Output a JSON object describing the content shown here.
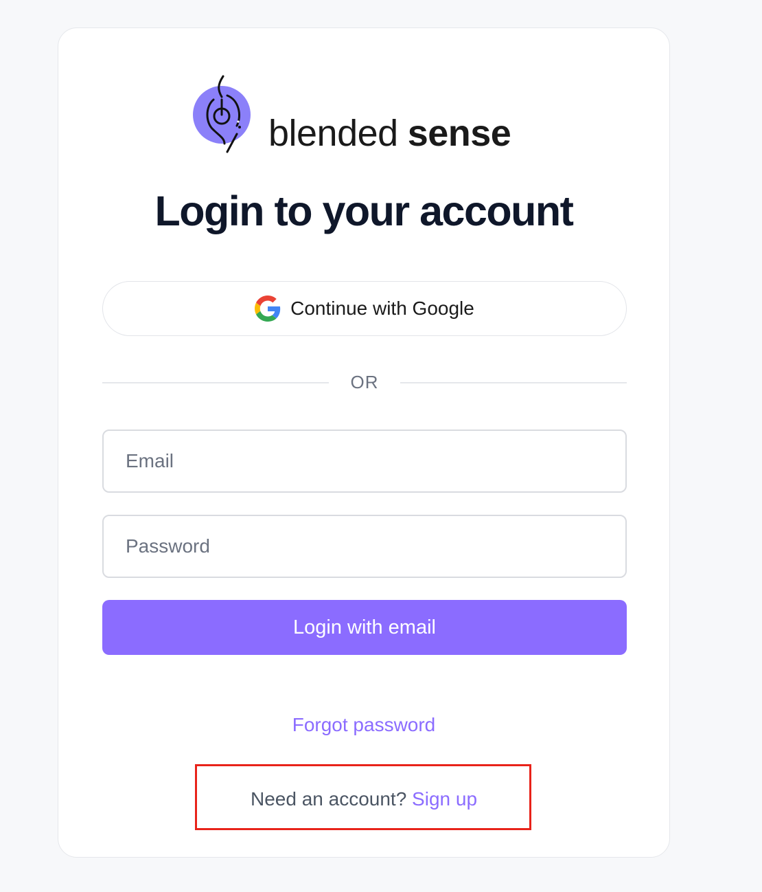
{
  "brand": {
    "name_light": "blended",
    "name_bold": "sense",
    "logo_icon": "blended-sense-logo-icon",
    "accent_color": "#8b6cff"
  },
  "title": "Login to your account",
  "google_button": {
    "label": "Continue with Google",
    "icon": "google-icon"
  },
  "divider_text": "OR",
  "email": {
    "placeholder": "Email",
    "value": ""
  },
  "password": {
    "placeholder": "Password",
    "value": ""
  },
  "login_button": {
    "label": "Login with email"
  },
  "forgot_password": "Forgot password",
  "signup": {
    "prompt": "Need an account?",
    "link": "Sign up"
  },
  "annotation": {
    "highlight_color": "#e8231a"
  }
}
